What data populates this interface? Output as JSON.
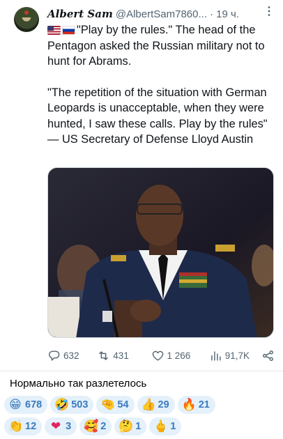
{
  "tweet": {
    "author_name": "Albert Sam",
    "handle": "@AlbertSam7860...",
    "time": "· 19 ч.",
    "flags": [
      "US flag",
      "Russian flag"
    ],
    "paragraph1": "\"Play by the rules.\" The head of the Pentagon asked the Russian military not to hunt for Abrams.",
    "paragraph2": "\"The repetition of the situation with German Leopards is unacceptable, when they were hunted, I saw these calls. Play by the rules\" — US Secretary of Defense Lloyd Austin",
    "media_icon": "photo-of-general-at-hearing",
    "stats": {
      "replies": "632",
      "retweets": "431",
      "likes": "1 266",
      "views": "91,7K"
    }
  },
  "caption": "Нормально так разлетелось",
  "reactions": [
    [
      {
        "emoji": "😁",
        "count": "678"
      },
      {
        "emoji": "🤣",
        "count": "503"
      },
      {
        "emoji": "🤏",
        "count": "54"
      },
      {
        "emoji": "👍",
        "count": "29"
      },
      {
        "emoji": "🔥",
        "count": "21"
      }
    ],
    [
      {
        "emoji": "👏",
        "count": "12"
      },
      {
        "emoji": "❤",
        "count": "3"
      },
      {
        "emoji": "🥰",
        "count": "2"
      },
      {
        "emoji": "🤔",
        "count": "1"
      },
      {
        "emoji": "🖕",
        "count": "1"
      }
    ]
  ],
  "colors": {
    "text": "#0f1419",
    "secondary": "#536471",
    "chip_bg": "#e4f0fa",
    "chip_text": "#3a7abf"
  }
}
